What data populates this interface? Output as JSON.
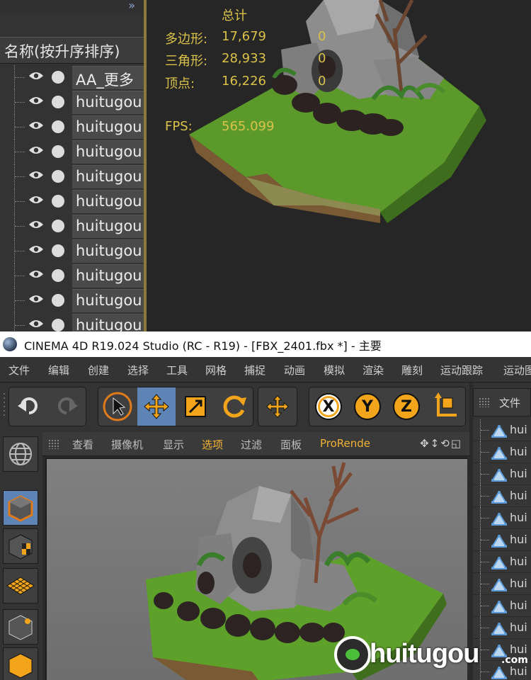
{
  "object_manager_zoom": {
    "expand_glyph": "»",
    "header": "名称(按升序排序)",
    "rows": [
      "AA_更多",
      "huitugou",
      "huitugou",
      "huitugou",
      "huitugou",
      "huitugou",
      "huitugou",
      "huitugou",
      "huitugou",
      "huitugou",
      "huitugou"
    ]
  },
  "viewport_stats": {
    "heading": "总计",
    "polygons_label": "多边形:",
    "polygons_value": "17,679",
    "polygons_selected": "0",
    "triangles_label": "三角形:",
    "triangles_value": "28,933",
    "triangles_selected": "0",
    "vertices_label": "顶点:",
    "vertices_value": "16,226",
    "vertices_selected": "0",
    "fps_label": "FPS:",
    "fps_value": "565.099"
  },
  "window": {
    "title": "CINEMA 4D R19.024 Studio (RC - R19) - [FBX_2401.fbx *] - 主要"
  },
  "menubar": [
    "文件",
    "编辑",
    "创建",
    "选择",
    "工具",
    "网格",
    "捕捉",
    "动画",
    "模拟",
    "渲染",
    "雕刻",
    "运动跟踪",
    "运动图"
  ],
  "toolbar": {
    "axis_x": "X",
    "axis_y": "Y",
    "axis_z": "Z"
  },
  "file_panel": {
    "label": "文件",
    "items": [
      "hui",
      "hui",
      "hui",
      "hui",
      "hui",
      "hui",
      "hui",
      "hui",
      "hui",
      "hui",
      "hui",
      "hui"
    ]
  },
  "viewport_menu": [
    "查看",
    "摄像机",
    "显示",
    "选项",
    "过滤",
    "面板",
    "ProRende"
  ],
  "viewport_nav_glyphs": "✥↕⟲◱",
  "watermark": {
    "text": "huitugou",
    "suffix": ".com"
  },
  "colors": {
    "accent": "#f2a51a",
    "selected": "#5d84b5",
    "stats": "#d9c24a",
    "highlight_menu": "#f2b233"
  }
}
